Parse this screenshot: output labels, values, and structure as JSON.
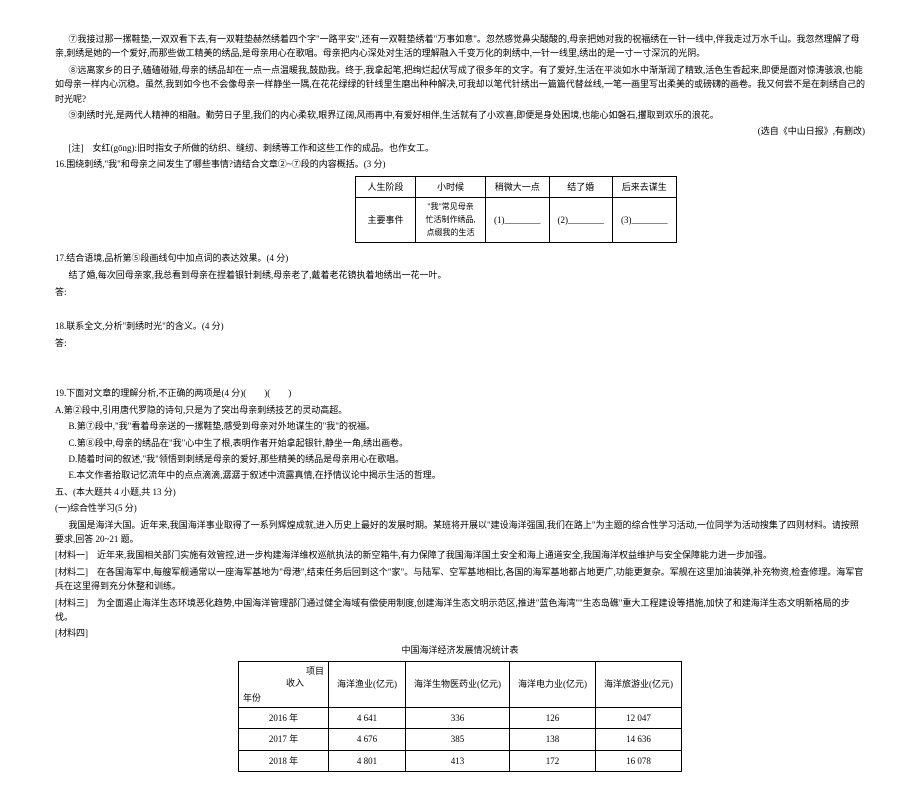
{
  "paras": {
    "p7": "⑦我接过那一摞鞋垫,一双双看下去,有一双鞋垫赫然绣着四个字\"一路平安\",还有一双鞋垫绣着\"万事如意\"。忽然感觉鼻尖酸酸的,母亲把她对我的祝福绣在一针一线中,伴我走过万水千山。我忽然理解了母亲,刺绣是她的一个爱好,而那些做工精美的绣品,是母亲用心在歌唱。母亲把内心深处对生活的理解融入千变万化的刺绣中,一针一线里,绣出的是一寸一寸深沉的光阴。",
    "p8": "⑧远离家乡的日子,磕磕碰碰,母亲的绣品却在一点一点温暖我,鼓励我。终于,我拿起笔,把绚烂起伏写成了很多年的文字。有了爱好,生活在平淡如水中渐渐润了精致,活色生香起来,即便是面对惊涛骇浪,也能如母亲一样内心沉稳。虽然,我到如今也不会像母亲一样静坐一隅,在花花绿绿的针线里生磨出种种解决,可我却以笔代针绣出一篇篇代替丝线,一笔一画里写出柔美的或磅礴的画卷。我又何尝不是在刺绣自己的时光呢?",
    "p9": "⑨刺绣时光,是两代人精神的相融。勤劳日子里,我们的内心柔软,眼界辽阔,风雨再中,有爱好相伴,生活就有了小欢喜,即便是身处困境,也能心如磐石,攫取到欢乐的浪花。",
    "p_source": "(选自《中山日报》,有删改)",
    "note": "[注]　女红(gōng):旧时指女子所做的纺织、缝纫、刺绣等工作和这些工作的成品。也作女工。",
    "q16": "16.围绕刺绣,\"我\"和母亲之间发生了哪些事情?请结合文章②~⑦段的内容概括。(3 分)",
    "q17": "17.结合语境,品析第⑤段画线句中加点词的表达效果。(4 分)",
    "q17_quote": "结了婚,每次回母亲家,我总看到母亲在捏着银针刺绣,母亲老了,戴着老花镜执着地绣出一花一叶。",
    "q17_ans": "答:",
    "q18": "18.联系全文,分析\"刺绣时光\"的含义。(4 分)",
    "q18_ans": "答:",
    "q19": "19.下面对文章的理解分析,不正确的两项是(4 分)(　　)(　　)",
    "q19a": "A.第②段中,引用唐代罗隐的诗句,只是为了突出母亲刺绣技艺的灵动高超。",
    "q19b": "B.第⑦段中,\"我\"看着母亲送的一摞鞋垫,感受到母亲对外地谋生的\"我\"的祝福。",
    "q19c": "C.第⑧段中,母亲的绣品在\"我\"心中生了根,表明作者开始拿起银针,静坐一角,绣出画卷。",
    "q19d": "D.随着时间的叙述,\"我\"领悟到刺绣是母亲的爱好,那些精美的绣品是母亲用心在歌唱。",
    "q19e": "E.本文作者拾取记忆流年中的点点滴滴,潺潺于叙述中流露真情,在抒情议论中揭示生活的哲理。",
    "sec5": "五、(本大题共 4 小题,共 13 分)",
    "sec5_1": "(一)综合性学习(5 分)",
    "intro5": "我国是海洋大国。近年来,我国海洋事业取得了一系列辉煌成就,进入历史上最好的发展时期。某班将开展以\"建设海洋强国,我们在路上\"为主题的综合性学习活动,一位同学为活动搜集了四则材料。请按照要求,回答 20~21 题。",
    "mat1": "[材料一]　近年来,我国相关部门实施有效管控,进一步构建海洋维权巡航执法的新空箱牛,有力保障了我国海洋国土安全和海上通道安全,我国海洋权益维护与安全保障能力进一步加强。",
    "mat2": "[材料二]　在各国海军中,每艘军舰通常以一座海军基地为\"母港\",结束任务后回到这个\"家\"。与陆军、空军基地相比,各国的海军基地都占地更广,功能更复杂。军舰在这里加油装弹,补充物资,检查修理。海军官兵在这里得到充分休整和训练。",
    "mat3": "[材料三]　为全面遏止海洋生态环境恶化趋势,中国海洋管理部门通过健全海域有偿使用制度,创建海洋生态文明示范区,推进\"蓝色海湾\"\"生态岛礁\"重大工程建设等措施,加快了和建海洋生态文明新格局的步伐。",
    "mat4": "[材料四]",
    "tbl2_title": "中国海洋经济发展情况统计表"
  },
  "table1": {
    "r1": [
      "人生阶段",
      "小时候",
      "稍微大一点",
      "结了婚",
      "后来去谋生"
    ],
    "r2_label": "主要事件",
    "r2c1": "\"我\"常见母亲忙活制作绣品,点缀我的生活",
    "blanks": [
      "(1)________",
      "(2)________",
      "(3)________"
    ]
  },
  "table2": {
    "head_proj": "项目",
    "head_rev": "收入",
    "head_year": "年份",
    "cols": [
      "海洋渔业(亿元)",
      "海洋生物医药业(亿元)",
      "海洋电力业(亿元)",
      "海洋旅游业(亿元)"
    ],
    "rows": [
      {
        "year": "2016 年",
        "v": [
          "4 641",
          "336",
          "126",
          "12 047"
        ]
      },
      {
        "year": "2017 年",
        "v": [
          "4 676",
          "385",
          "138",
          "14 636"
        ]
      },
      {
        "year": "2018 年",
        "v": [
          "4 801",
          "413",
          "172",
          "16 078"
        ]
      }
    ]
  }
}
